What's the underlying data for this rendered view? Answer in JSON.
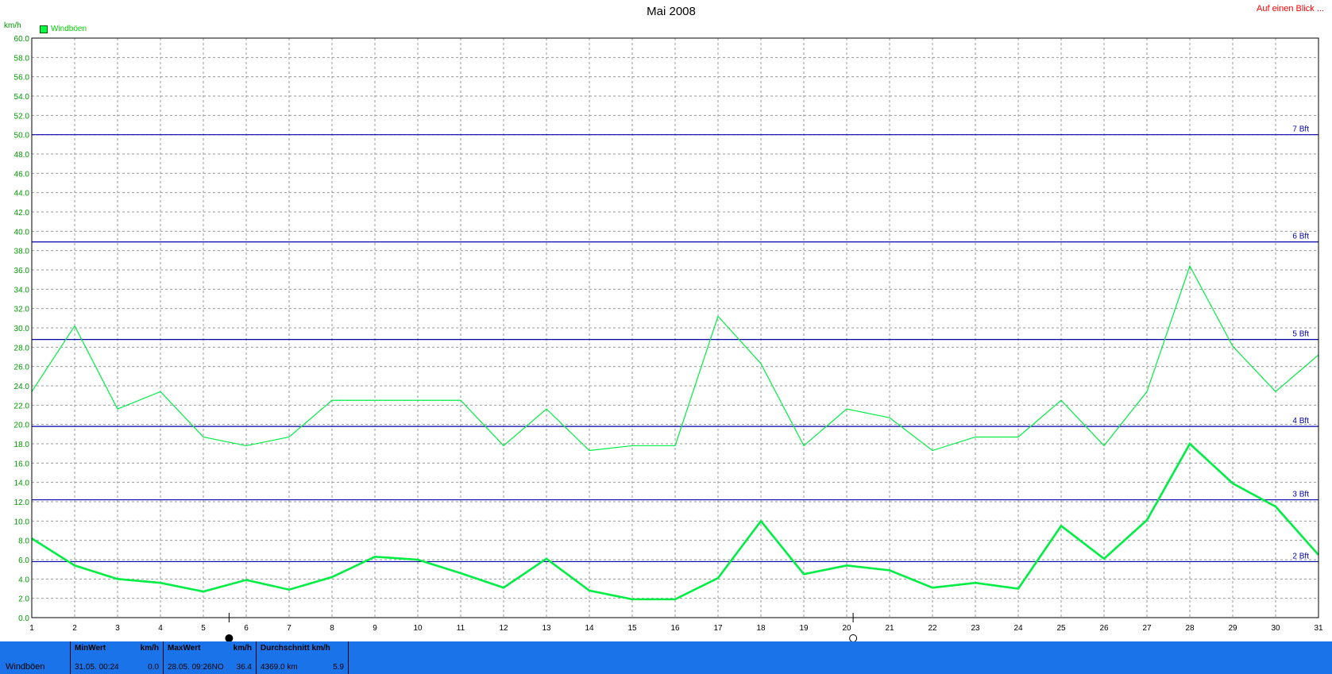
{
  "header": {
    "title": "Mai 2008",
    "link_label": "Auf einen Blick ..."
  },
  "colors": {
    "series_line": "#00ee44",
    "beaufort_line": "#0000aa",
    "tick_label": "#009900",
    "footer_bg": "#1a73e8"
  },
  "chart_data": {
    "type": "line",
    "title": "Mai 2008",
    "ylabel": "km/h",
    "xlabel": "",
    "x": [
      1,
      2,
      3,
      4,
      5,
      6,
      7,
      8,
      9,
      10,
      11,
      12,
      13,
      14,
      15,
      16,
      17,
      18,
      19,
      20,
      21,
      22,
      23,
      24,
      25,
      26,
      27,
      28,
      29,
      30,
      31
    ],
    "xlim": [
      1,
      31
    ],
    "ylim": [
      0,
      60
    ],
    "y_ticks": [
      "0.0",
      "2.0",
      "4.0",
      "6.0",
      "8.0",
      "10.0",
      "12.0",
      "14.0",
      "16.0",
      "18.0",
      "20.0",
      "22.0",
      "24.0",
      "26.0",
      "28.0",
      "30.0",
      "32.0",
      "34.0",
      "36.0",
      "38.0",
      "40.0",
      "42.0",
      "44.0",
      "46.0",
      "48.0",
      "50.0",
      "52.0",
      "54.0",
      "56.0",
      "58.0",
      "60.0"
    ],
    "x_ticks": [
      "1",
      "2",
      "3",
      "4",
      "5",
      "6",
      "7",
      "8",
      "9",
      "10",
      "11",
      "12",
      "13",
      "14",
      "15",
      "16",
      "17",
      "18",
      "19",
      "20",
      "21",
      "22",
      "23",
      "24",
      "25",
      "26",
      "27",
      "28",
      "29",
      "30",
      "31"
    ],
    "grid": true,
    "legend": {
      "position": "top-left",
      "entries": [
        "Windböen"
      ]
    },
    "series": [
      {
        "name": "Windböen",
        "role": "max",
        "values": [
          23.4,
          30.2,
          21.6,
          23.4,
          18.7,
          17.8,
          18.7,
          22.5,
          22.5,
          22.5,
          22.5,
          17.8,
          21.6,
          17.3,
          17.8,
          17.8,
          31.2,
          26.3,
          17.8,
          21.6,
          20.7,
          17.3,
          18.7,
          18.7,
          22.5,
          17.8,
          23.4,
          36.4,
          28.1,
          23.4,
          27.2
        ]
      },
      {
        "name": "Windböen",
        "role": "avg",
        "values": [
          8.2,
          5.4,
          4.0,
          3.6,
          2.7,
          3.9,
          2.9,
          4.2,
          6.3,
          6.0,
          4.6,
          3.1,
          6.1,
          2.8,
          1.9,
          1.9,
          4.1,
          10.0,
          4.5,
          5.4,
          4.9,
          3.1,
          3.6,
          3.0,
          9.5,
          6.1,
          10.1,
          18.0,
          13.9,
          11.5,
          6.5
        ]
      }
    ],
    "reference_lines": [
      {
        "label": "2 Bft",
        "value": 5.8
      },
      {
        "label": "3 Bft",
        "value": 12.2
      },
      {
        "label": "4 Bft",
        "value": 19.8
      },
      {
        "label": "5 Bft",
        "value": 28.8
      },
      {
        "label": "6 Bft",
        "value": 38.9
      },
      {
        "label": "7 Bft",
        "value": 50.0
      }
    ],
    "moon_markers": [
      {
        "icon": "full-moon-icon",
        "day": 5.6
      },
      {
        "icon": "new-moon-icon",
        "day": 20.15
      }
    ]
  },
  "footer": {
    "label": "Windböen",
    "min": {
      "header": "MinWert",
      "unit": "km/h",
      "date_time": "31.05.  00:24",
      "value": "0.0"
    },
    "max": {
      "header": "MaxWert",
      "unit": "km/h",
      "date_time": "28.05.  09:26NO",
      "value": "36.4"
    },
    "avg": {
      "header": "Durchschnitt km/h",
      "distance": "4369.0 km",
      "value": "5.9"
    }
  }
}
